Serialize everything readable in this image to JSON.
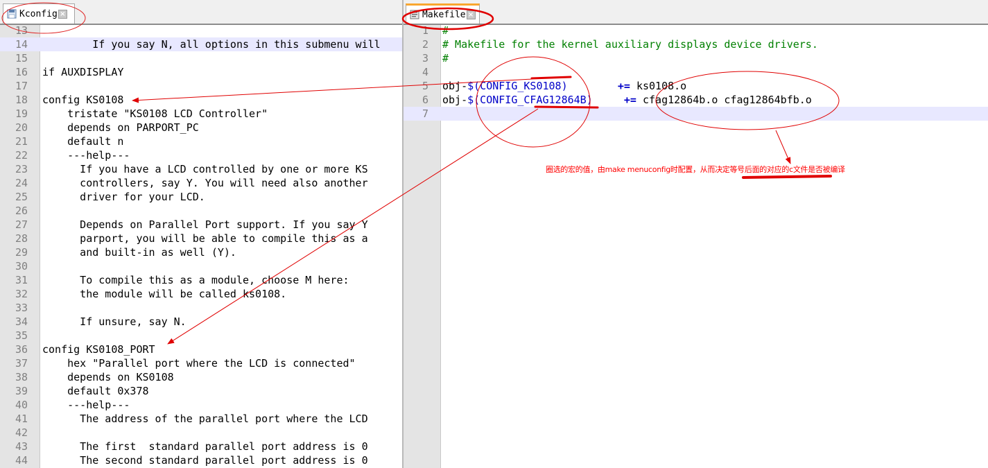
{
  "left": {
    "tab": {
      "title": "Kconfig",
      "close": "×",
      "icon": "file-icon"
    },
    "lines": [
      {
        "n": "13",
        "text": ""
      },
      {
        "n": "14",
        "text": "\tIf you say N, all options in this submenu will",
        "current": true
      },
      {
        "n": "15",
        "text": ""
      },
      {
        "n": "16",
        "text": "if AUXDISPLAY"
      },
      {
        "n": "17",
        "text": ""
      },
      {
        "n": "18",
        "text": "config KS0108"
      },
      {
        "n": "19",
        "text": "    tristate \"KS0108 LCD Controller\""
      },
      {
        "n": "20",
        "text": "    depends on PARPORT_PC"
      },
      {
        "n": "21",
        "text": "    default n"
      },
      {
        "n": "22",
        "text": "    ---help---"
      },
      {
        "n": "23",
        "text": "      If you have a LCD controlled by one or more KS"
      },
      {
        "n": "24",
        "text": "      controllers, say Y. You will need also another"
      },
      {
        "n": "25",
        "text": "      driver for your LCD."
      },
      {
        "n": "26",
        "text": ""
      },
      {
        "n": "27",
        "text": "      Depends on Parallel Port support. If you say Y"
      },
      {
        "n": "28",
        "text": "      parport, you will be able to compile this as a"
      },
      {
        "n": "29",
        "text": "      and built-in as well (Y)."
      },
      {
        "n": "30",
        "text": ""
      },
      {
        "n": "31",
        "text": "      To compile this as a module, choose M here:"
      },
      {
        "n": "32",
        "text": "      the module will be called ks0108."
      },
      {
        "n": "33",
        "text": ""
      },
      {
        "n": "34",
        "text": "      If unsure, say N."
      },
      {
        "n": "35",
        "text": ""
      },
      {
        "n": "36",
        "text": "config KS0108_PORT"
      },
      {
        "n": "37",
        "text": "    hex \"Parallel port where the LCD is connected\""
      },
      {
        "n": "38",
        "text": "    depends on KS0108"
      },
      {
        "n": "39",
        "text": "    default 0x378"
      },
      {
        "n": "40",
        "text": "    ---help---"
      },
      {
        "n": "41",
        "text": "      The address of the parallel port where the LCD"
      },
      {
        "n": "42",
        "text": ""
      },
      {
        "n": "43",
        "text": "      The first  standard parallel port address is 0"
      },
      {
        "n": "44",
        "text": "      The second standard parallel port address is 0"
      }
    ]
  },
  "right": {
    "tab": {
      "title": "Makefile",
      "close": "×",
      "icon": "makefile-icon"
    },
    "lines": [
      {
        "n": "1",
        "type": "comment",
        "text": "#"
      },
      {
        "n": "2",
        "type": "comment",
        "text": "# Makefile for the kernel auxiliary displays device drivers."
      },
      {
        "n": "3",
        "type": "comment",
        "text": "#"
      },
      {
        "n": "4",
        "type": "blank",
        "text": ""
      },
      {
        "n": "5",
        "type": "rule",
        "prefix": "obj-",
        "macro": "$(CONFIG_KS0108)",
        "pad": "        ",
        "op": "+=",
        "value": " ks0108.o"
      },
      {
        "n": "6",
        "type": "rule",
        "prefix": "obj-",
        "macro": "$(CONFIG_CFAG12864B)",
        "pad": "     ",
        "op": "+=",
        "value": " cfag12864b.o cfag12864bfb.o"
      },
      {
        "n": "7",
        "type": "blank",
        "text": "",
        "current": true
      }
    ]
  },
  "annotation": {
    "text": "圈选的宏的值，由make menuconfig时配置，从而决定等号后面的对应的c文件是否被编译",
    "color": "#ff0000"
  }
}
